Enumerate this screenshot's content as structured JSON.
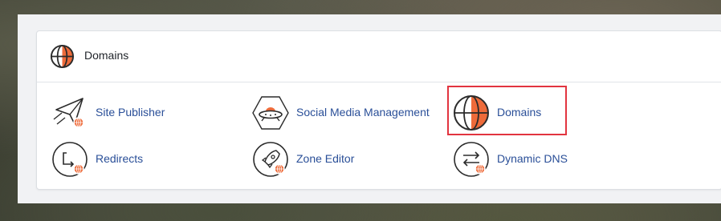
{
  "section": {
    "title": "Domains",
    "icon": "globe-icon"
  },
  "tools": [
    {
      "label": "Site Publisher",
      "icon": "paper-plane-icon"
    },
    {
      "label": "Social Media Management",
      "icon": "ufo-icon"
    },
    {
      "label": "Domains",
      "icon": "globe-icon",
      "highlighted": true
    },
    {
      "label": "Redirects",
      "icon": "redirect-arrow-icon"
    },
    {
      "label": "Zone Editor",
      "icon": "rocket-icon"
    },
    {
      "label": "Dynamic DNS",
      "icon": "swap-arrows-icon"
    }
  ],
  "colors": {
    "accent": "#ee6b3a",
    "link": "#2a4f98",
    "highlight_border": "#e2343f",
    "icon_stroke": "#2b2b2b"
  }
}
